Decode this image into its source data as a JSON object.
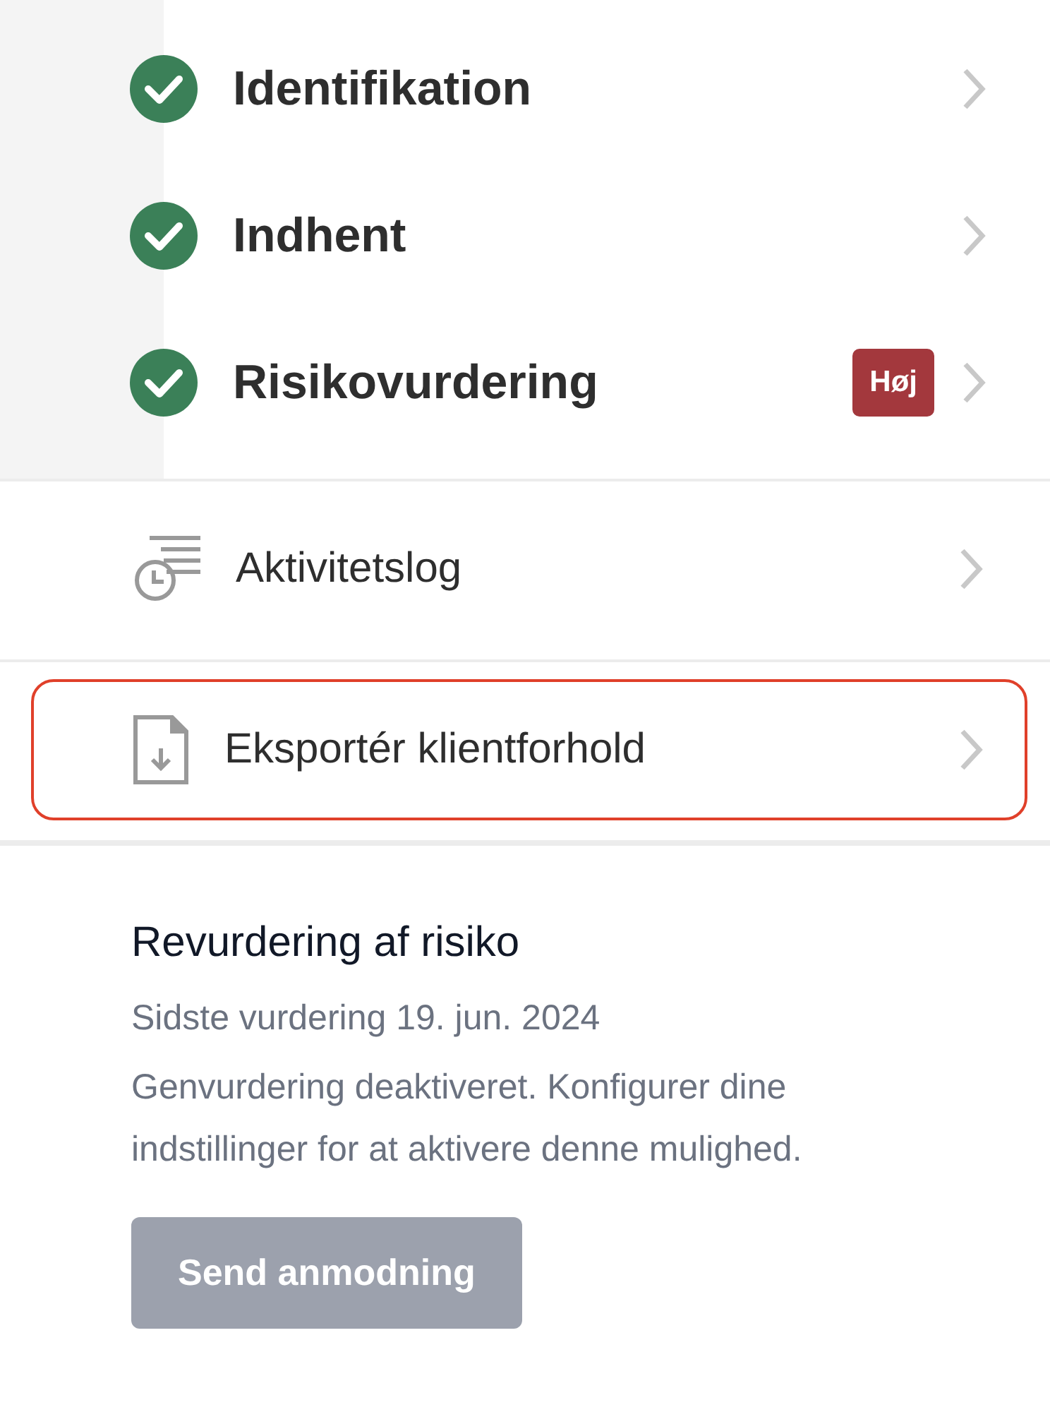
{
  "steps": [
    {
      "label": "Identifikation",
      "done": true
    },
    {
      "label": "Indhent",
      "done": true
    },
    {
      "label": "Risikovurdering",
      "done": true,
      "badge": "Høj"
    }
  ],
  "actions": [
    {
      "kind": "log",
      "label": "Aktivitetslog",
      "highlighted": false
    },
    {
      "kind": "export",
      "label": "Eksportér klientforhold",
      "highlighted": true
    }
  ],
  "reassessment": {
    "title": "Revurdering af risiko",
    "last_assessed": "Sidste vurdering 19. jun. 2024",
    "message": "Genvurdering deaktiveret. Konfigurer dine indstillinger for at aktivere denne mulighed.",
    "button": {
      "label": "Send anmodning",
      "disabled": true
    }
  }
}
